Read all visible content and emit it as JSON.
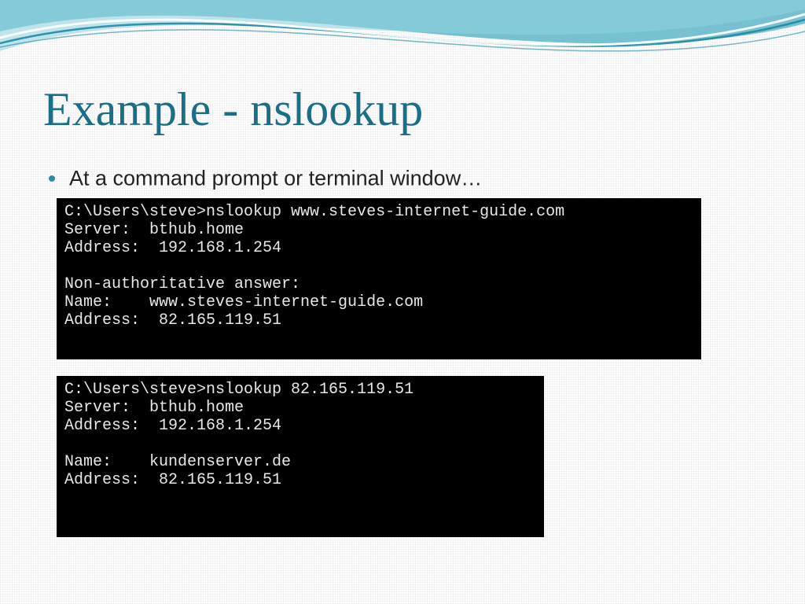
{
  "title": "Example - nslookup",
  "bullet": "At a command prompt or terminal window…",
  "terminals": {
    "t1": "C:\\Users\\steve>nslookup www.steves-internet-guide.com\nServer:  bthub.home\nAddress:  192.168.1.254\n\nNon-authoritative answer:\nName:    www.steves-internet-guide.com\nAddress:  82.165.119.51",
    "t2": "C:\\Users\\steve>nslookup 82.165.119.51\nServer:  bthub.home\nAddress:  192.168.1.254\n\nName:    kundenserver.de\nAddress:  82.165.119.51"
  },
  "colors": {
    "accent": "#1a6e85",
    "swooshDark": "#2f90aa",
    "swooshLight": "#bfe6ef"
  }
}
